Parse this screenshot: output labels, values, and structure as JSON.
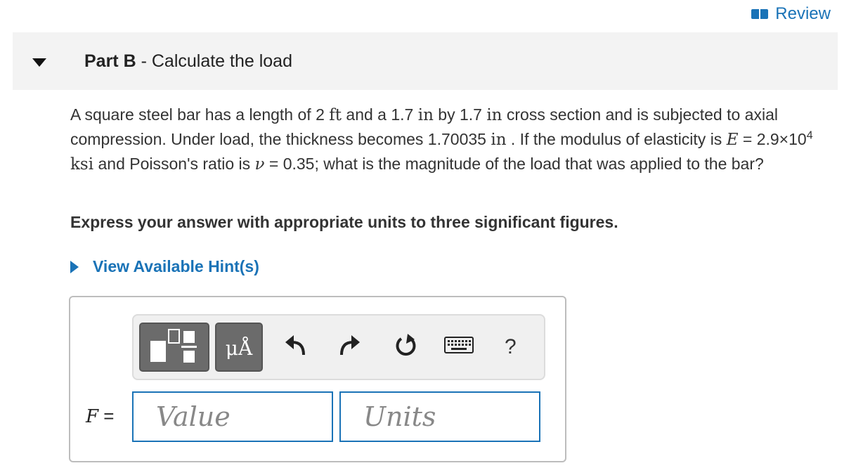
{
  "review": {
    "label": "Review"
  },
  "part": {
    "prefix": "Part B",
    "separator": " - ",
    "title": "Calculate the load"
  },
  "problem": {
    "s1": "A square steel bar has a length of 2 ",
    "u_ft": "ft",
    "s2": " and a 1.7 ",
    "u_in1": "in",
    "s3": " by 1.7 ",
    "u_in2": "in",
    "s4": " cross section and is subjected to axial compression. Under load, the thickness becomes 1.70035 ",
    "u_in3": "in",
    "s5": " . If the modulus of elasticity is ",
    "sym_E": "E",
    "s6": " = 2.9×10",
    "exp": "4",
    "s7": " ",
    "u_ksi": "ksi",
    "s8": " and Poisson's ratio is ",
    "sym_nu": "ν",
    "s9": " = 0.35; what is the magnitude of the load that was applied to the bar?"
  },
  "instruction": "Express your answer with appropriate units to three significant figures.",
  "hint": {
    "label": "View Available Hint(s)"
  },
  "toolbar": {
    "units_symbol": "μÅ",
    "help_label": "?",
    "icons": [
      "templates-icon",
      "units-icon",
      "undo-icon",
      "redo-icon",
      "reset-icon",
      "keyboard-icon",
      "help-icon"
    ]
  },
  "answer": {
    "variable": "F",
    "equals": " =",
    "value_placeholder": "Value",
    "units_placeholder": "Units"
  },
  "colors": {
    "accent": "#1a73b7",
    "header_bg": "#f3f3f3",
    "tool_dark": "#6b6b6b"
  }
}
